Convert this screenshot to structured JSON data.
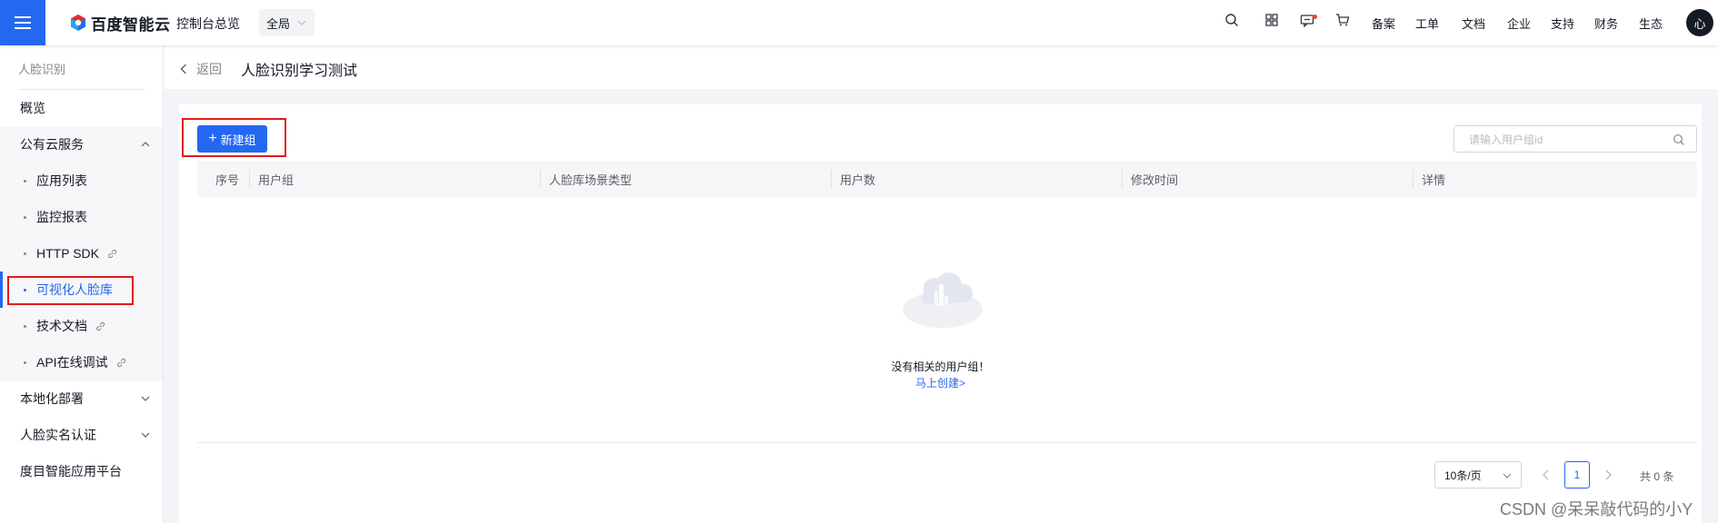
{
  "topbar": {
    "logo_text": "百度智能云",
    "console_label": "控制台总览",
    "region_label": "全局",
    "nav": [
      "备案",
      "工单",
      "文档",
      "企业",
      "支持",
      "财务",
      "生态"
    ],
    "icons": [
      "search-icon",
      "apps-icon",
      "message-icon",
      "cart-icon"
    ],
    "avatar_text": "心"
  },
  "sidebar": {
    "title": "人脸识别",
    "overview": "概览",
    "public_cloud": "公有云服务",
    "sub_items": [
      "应用列表",
      "监控报表",
      "HTTP SDK",
      "可视化人脸库",
      "技术文档",
      "API在线调试"
    ],
    "local_deploy": "本地化部署",
    "realname": "人脸实名认证",
    "platform": "度目智能应用平台"
  },
  "header": {
    "back_label": "返回",
    "title": "人脸识别学习测试"
  },
  "main": {
    "new_group_label": "新建组",
    "search_placeholder": "请输入用户组id",
    "columns": [
      "序号",
      "用户组",
      "人脸库场景类型",
      "用户数",
      "修改时间",
      "详情"
    ],
    "empty_text": "没有相关的用户组！",
    "empty_link": "马上创建>"
  },
  "pagination": {
    "page_size": "10条/页",
    "current_page": "1",
    "total": "共 0 条"
  },
  "watermark": "CSDN @呆呆敲代码的小Y",
  "colors": {
    "primary": "#2468f2",
    "highlight_box": "#e11a1a"
  }
}
